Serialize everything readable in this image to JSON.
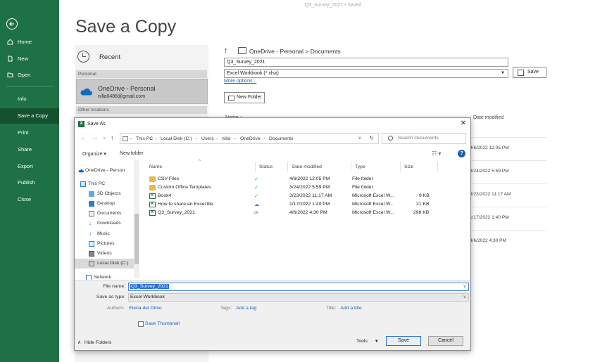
{
  "document_title": "Q3_Survey_2021 • Saved",
  "rail": {
    "items": [
      {
        "label": "Home",
        "icon": "home-icon"
      },
      {
        "label": "New",
        "icon": "new-doc-icon"
      },
      {
        "label": "Open",
        "icon": "open-folder-icon"
      },
      {
        "label": "Info"
      },
      {
        "label": "Save a Copy"
      },
      {
        "label": "Print"
      },
      {
        "label": "Share"
      },
      {
        "label": "Export"
      },
      {
        "label": "Publish"
      },
      {
        "label": "Close"
      }
    ]
  },
  "backstage": {
    "heading": "Save a Copy",
    "recent": "Recent",
    "group_personal": "Personal",
    "onedrive_name": "OneDrive - Personal",
    "onedrive_email": "nilla6486@gmail.com",
    "group_other": "Other locations",
    "path": "OneDrive - Personal > Documents",
    "filename": "Q3_Survey_2021",
    "filetype": "Excel Workbook (*.xlsx)",
    "more_options": "More options...",
    "save_button": "Save",
    "new_folder_button": "New Folder",
    "col_name": "Name ↑",
    "col_date": "Date modified",
    "dates": [
      "4/6/2022 12:05 PM",
      "3/24/2022 5:59 PM",
      "3/23/2022 11:17 AM",
      "1/17/2022 1:40 PM",
      "4/6/2022 4:30 PM"
    ]
  },
  "dialog": {
    "title": "Save As",
    "breadcrumb": [
      "This PC",
      "Local Disk (C:)",
      "Users",
      "nilla",
      "OneDrive",
      "Documents"
    ],
    "search_placeholder": "Search Documents",
    "organize": "Organize ▾",
    "new_folder": "New folder",
    "tree": [
      {
        "label": "OneDrive - Person"
      },
      {
        "label": "This PC"
      },
      {
        "label": "3D Objects"
      },
      {
        "label": "Desktop"
      },
      {
        "label": "Documents"
      },
      {
        "label": "Downloads"
      },
      {
        "label": "Music"
      },
      {
        "label": "Pictures"
      },
      {
        "label": "Videos"
      },
      {
        "label": "Local Disk (C:)"
      },
      {
        "label": "Network"
      }
    ],
    "columns": {
      "name": "Name",
      "status": "Status",
      "date": "Date modified",
      "type": "Type",
      "size": "Size"
    },
    "files": [
      {
        "name": "CSV Files",
        "status": "✓",
        "date": "4/6/2022 12:05 PM",
        "type": "File folder",
        "size": "",
        "kind": "folder"
      },
      {
        "name": "Custom Office Templates",
        "status": "✓",
        "date": "3/24/2022 5:59 PM",
        "type": "File folder",
        "size": "",
        "kind": "folder"
      },
      {
        "name": "Book4",
        "status": "✓",
        "date": "3/23/2022 11:17 AM",
        "type": "Microsoft Excel W...",
        "size": "9 KB",
        "kind": "xl"
      },
      {
        "name": "How to share an Excel file",
        "status": "☁",
        "date": "1/17/2022 1:40 PM",
        "type": "Microsoft Excel W...",
        "size": "21 KB",
        "kind": "xl"
      },
      {
        "name": "Q3_Survey_2021",
        "status": "⟳",
        "date": "4/6/2022 4:30 PM",
        "type": "Microsoft Excel W...",
        "size": "298 KB",
        "kind": "xl"
      }
    ],
    "file_name_label": "File name:",
    "file_name_value": "Q3_Survey_2021",
    "save_type_label": "Save as type:",
    "save_type_value": "Excel Workbook",
    "authors_label": "Authors:",
    "authors_value": "Elena del Olmo",
    "tags_label": "Tags:",
    "tags_value": "Add a tag",
    "title_label": "Title:",
    "title_value": "Add a title",
    "save_thumbnail": "Save Thumbnail",
    "hide_folders": "Hide Folders",
    "tools": "Tools",
    "save": "Save",
    "cancel": "Cancel"
  },
  "colors": {
    "excel_green": "#1e7145",
    "link_blue": "#1a5fb4"
  }
}
